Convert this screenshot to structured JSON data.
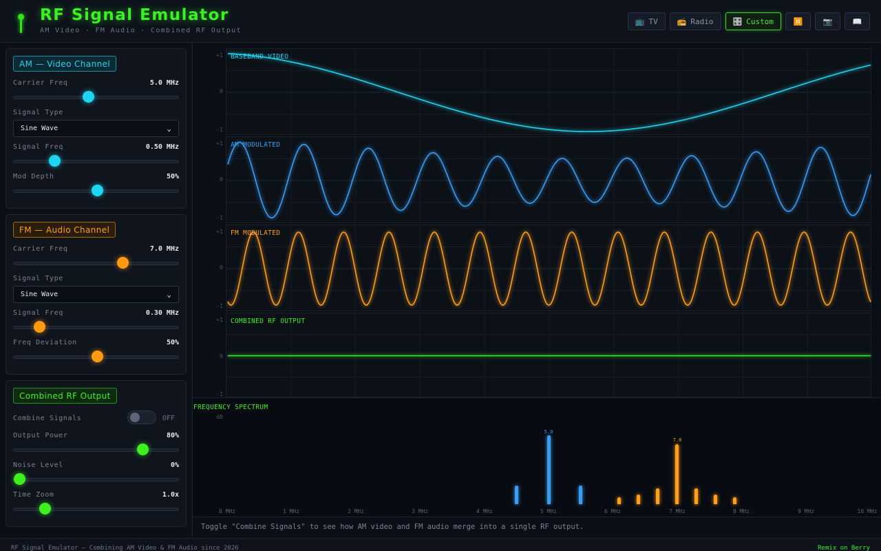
{
  "header": {
    "title": "RF Signal Emulator",
    "subtitle": "AM Video · FM Audio · Combined RF Output",
    "presets": [
      {
        "icon": "📺",
        "label": "TV",
        "active": false
      },
      {
        "icon": "📻",
        "label": "Radio",
        "active": false
      },
      {
        "icon": "🎛️",
        "label": "Custom",
        "active": true
      }
    ],
    "pause_icon": "⏸️",
    "camera_icon": "📷",
    "docs_icon": "📖"
  },
  "am_panel": {
    "title": "AM — Video Channel",
    "carrier_label": "Carrier Freq",
    "carrier_value": "5.0 MHz",
    "carrier_level": 0.45,
    "type_label": "Signal Type",
    "type_value": "Sine Wave",
    "signal_label": "Signal Freq",
    "signal_value": "0.50 MHz",
    "signal_level": 0.245,
    "depth_label": "Mod Depth",
    "depth_value": "50%",
    "depth_level": 0.5
  },
  "fm_panel": {
    "title": "FM — Audio Channel",
    "carrier_label": "Carrier Freq",
    "carrier_value": "7.0 MHz",
    "carrier_level": 0.655,
    "type_label": "Signal Type",
    "type_value": "Sine Wave",
    "signal_label": "Signal Freq",
    "signal_value": "0.30 MHz",
    "signal_level": 0.155,
    "dev_label": "Freq Deviation",
    "dev_value": "50%",
    "dev_level": 0.5
  },
  "rf_panel": {
    "title": "Combined RF Output",
    "combine_label": "Combine Signals",
    "combine_state": "OFF",
    "power_label": "Output Power",
    "power_value": "80%",
    "power_level": 0.775,
    "noise_label": "Noise Level",
    "noise_value": "0%",
    "noise_level": 0.035,
    "zoom_label": "Time Zoom",
    "zoom_value": "1.0x",
    "zoom_level": 0.185
  },
  "scopes": {
    "ticks": {
      "top": "+1",
      "mid": "0",
      "bottom": "-1"
    },
    "baseband_label": "BASEBAND VIDEO",
    "am_label": "AM MODULATED",
    "fm_label": "FM MODULATED",
    "rf_label": "COMBINED RF OUTPUT",
    "colors": {
      "baseband": "#22d3ee",
      "am": "#3b9cf2",
      "fm": "#ff9e1b",
      "rf": "#3cf026"
    }
  },
  "spectrum": {
    "title": "FREQUENCY SPECTRUM",
    "unit": "dB",
    "x_ticks": [
      "0 MHz",
      "1 MHz",
      "2 MHz",
      "3 MHz",
      "4 MHz",
      "5 MHz",
      "6 MHz",
      "7 MHz",
      "8 MHz",
      "9 MHz",
      "10 MHz"
    ],
    "peak_labels": {
      "am": "5.0",
      "fm": "7.0"
    },
    "bars": [
      {
        "f": 4.5,
        "level": 0.27,
        "kind": "am"
      },
      {
        "f": 5.0,
        "level": 1.0,
        "kind": "am"
      },
      {
        "f": 5.5,
        "level": 0.27,
        "kind": "am"
      },
      {
        "f": 6.1,
        "level": 0.1,
        "kind": "fm"
      },
      {
        "f": 6.4,
        "level": 0.14,
        "kind": "fm"
      },
      {
        "f": 6.7,
        "level": 0.23,
        "kind": "fm"
      },
      {
        "f": 7.0,
        "level": 0.87,
        "kind": "fm"
      },
      {
        "f": 7.3,
        "level": 0.23,
        "kind": "fm"
      },
      {
        "f": 7.6,
        "level": 0.14,
        "kind": "fm"
      },
      {
        "f": 7.9,
        "level": 0.1,
        "kind": "fm"
      }
    ]
  },
  "hint": "Toggle \"Combine Signals\" to see how AM video and FM audio merge into a single RF output.",
  "footer": {
    "left": "RF Signal Emulator — Combining AM Video & FM Audio since 2026",
    "right": "Remix on Berry"
  }
}
